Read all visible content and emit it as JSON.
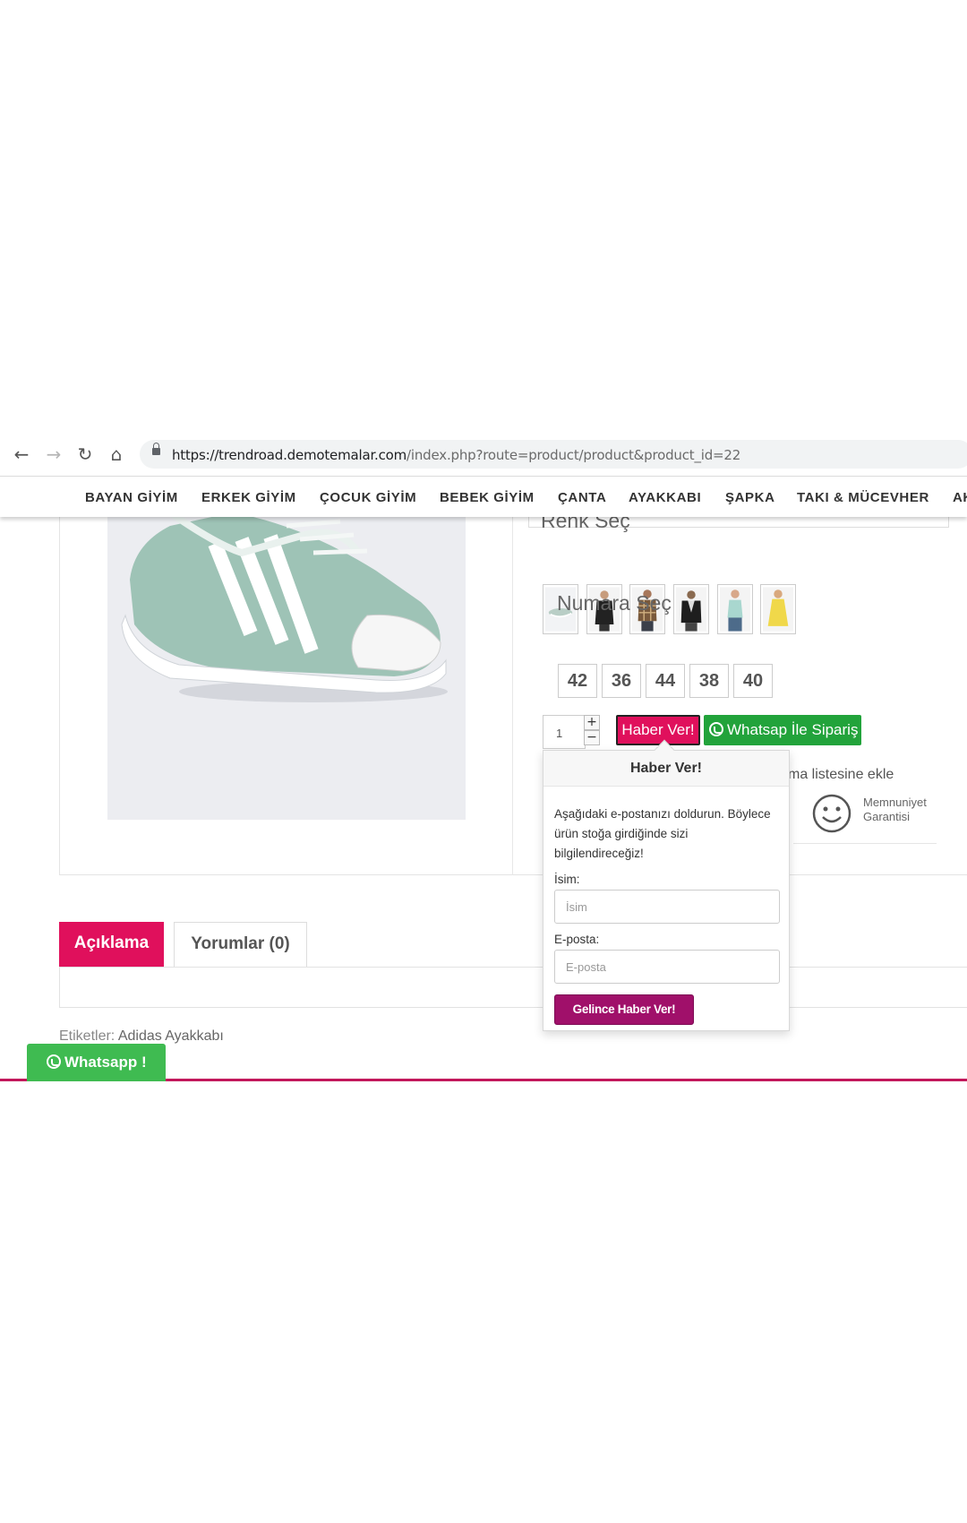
{
  "browser": {
    "url_host": "https://trendroad.demotemalar.com",
    "url_path": "/index.php?route=product/product&product_id=22"
  },
  "menu": {
    "items": [
      "BAYAN GİYİM",
      "ERKEK GİYİM",
      "ÇOCUK GİYİM",
      "BEBEK GİYİM",
      "ÇANTA",
      "AYAKKABI",
      "ŞAPKA",
      "TAKI & MÜCEVHER",
      "AK"
    ]
  },
  "product": {
    "color_title": "Renk Seç",
    "size_title": "Numara Seç",
    "sizes": [
      "42",
      "36",
      "44",
      "38",
      "40"
    ],
    "quantity": "1",
    "qty_plus": "+",
    "qty_minus": "−",
    "notify_label": "Haber Ver!",
    "whatsapp_order_label": "Whatsap İle Sipariş",
    "compare_text": "ma listesine ekle",
    "satisfaction_line1": "Memnuniyet",
    "satisfaction_line2": "Garantisi"
  },
  "popover": {
    "title": "Haber Ver!",
    "description": "Aşağıdaki e-postanızı doldurun. Böylece ürün stoğa girdiğinde sizi bilgilendireceğiz!",
    "name_label": "İsim:",
    "name_placeholder": "İsim",
    "email_label": "E-posta:",
    "email_placeholder": "E-posta",
    "submit_label": "Gelince Haber Ver!"
  },
  "tabs": {
    "description": "Açıklama",
    "reviews": "Yorumlar (0)"
  },
  "tags": {
    "label": "Etiketler:",
    "value": "Adidas Ayakkabı"
  },
  "whatsapp_float": {
    "label": "Whatsapp !"
  },
  "colors": {
    "accent": "#e0105c",
    "whatsapp": "#22a33b",
    "submit": "#a0106a",
    "divider": "#c2185b"
  }
}
